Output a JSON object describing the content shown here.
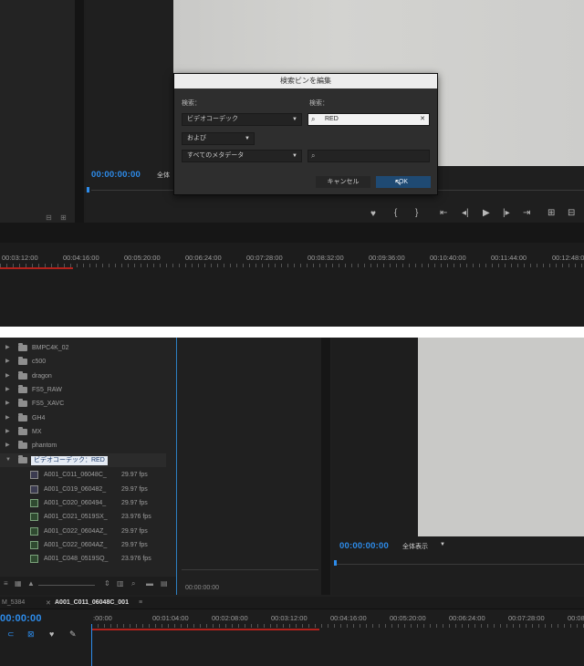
{
  "top": {
    "dialog": {
      "title": "検索ビンを編集",
      "left_label": "検索：",
      "right_label": "検索：",
      "dropdown1": "ビデオコーデック",
      "dropdown2": "および",
      "dropdown3": "すべてのメタデータ",
      "search1_value": "RED",
      "search2_value": "",
      "cancel_label": "キャンセル",
      "ok_label": "OK"
    },
    "monitor": {
      "timecode": "00:00:00:00",
      "fit_label": "全体"
    },
    "timeline": {
      "ruler": [
        "00:03:12:00",
        "00:04:16:00",
        "00:05:20:00",
        "00:06:24:00",
        "00:07:28:00",
        "00:08:32:00",
        "00:09:36:00",
        "00:10:40:00",
        "00:11:44:00",
        "00:12:48:0"
      ]
    }
  },
  "bottom": {
    "project": {
      "folders": [
        "BMPC4K_02",
        "c500",
        "dragon",
        "FS5_RAW",
        "FS5_XAVC",
        "GH4",
        "MX",
        "phantom"
      ],
      "search_bin": "ビデオコーデック：RED",
      "clips": [
        {
          "name": "A001_C011_06048C_",
          "fps": "29.97 fps",
          "kind": "clip"
        },
        {
          "name": "A001_C019_060482_",
          "fps": "29.97 fps",
          "kind": "clip"
        },
        {
          "name": "A001_C020_060494_",
          "fps": "29.97 fps",
          "kind": "seq"
        },
        {
          "name": "A001_C021_0519SX_",
          "fps": "23.976 fps",
          "kind": "seq"
        },
        {
          "name": "A001_C022_0604AZ_",
          "fps": "29.97 fps",
          "kind": "seq"
        },
        {
          "name": "A001_C022_0604AZ_",
          "fps": "29.97 fps",
          "kind": "seq"
        },
        {
          "name": "A001_C048_0519SQ_",
          "fps": "23.976 fps",
          "kind": "seq"
        }
      ]
    },
    "middle_timecode": "00:00:00:00",
    "monitor": {
      "timecode": "00:00:00:00",
      "fit_label": "全体表示"
    },
    "tabs": {
      "left_tab": "M_5384",
      "active_tab": "A001_C011_06048C_001"
    },
    "timeline": {
      "timecode": "00:00:00",
      "ruler": [
        ":00:00",
        "00:01:04:00",
        "00:02:08:00",
        "00:03:12:00",
        "00:04:16:00",
        "00:05:20:00",
        "00:06:24:00",
        "00:07:28:00",
        "00:08:32:00"
      ]
    }
  },
  "colors": {
    "accent": "#2d8ceb",
    "playrange": "#b2221c",
    "panel_border": "#2d7fc1"
  }
}
